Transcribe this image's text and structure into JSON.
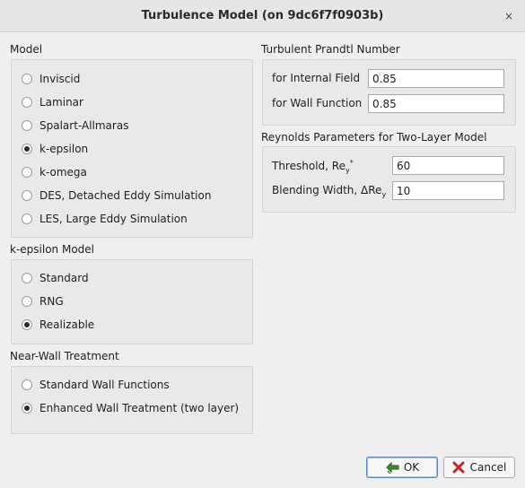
{
  "window": {
    "title": "Turbulence Model (on 9dc6f7f0903b)",
    "close_glyph": "×"
  },
  "model": {
    "label": "Model",
    "options": [
      "Inviscid",
      "Laminar",
      "Spalart-Allmaras",
      "k-epsilon",
      "k-omega",
      "DES, Detached Eddy Simulation",
      "LES, Large Eddy Simulation"
    ],
    "selected": "k-epsilon"
  },
  "kepsilon": {
    "label": "k-epsilon Model",
    "options": [
      "Standard",
      "RNG",
      "Realizable"
    ],
    "selected": "Realizable"
  },
  "near_wall": {
    "label": "Near-Wall Treatment",
    "options": [
      "Standard Wall Functions",
      "Enhanced Wall Treatment (two layer)"
    ],
    "selected": "Enhanced Wall Treatment (two layer)"
  },
  "prandtl": {
    "label": "Turbulent Prandtl Number",
    "internal_label": "for Internal Field",
    "internal_value": "0.85",
    "wall_label": "for Wall Function",
    "wall_value": "0.85"
  },
  "reynolds": {
    "label": "Reynolds Parameters for Two-Layer Model",
    "threshold_label": "Threshold, Re",
    "threshold_sub": "y",
    "threshold_sup": "*",
    "threshold_value": "60",
    "blending_label": "Blending Width, ΔRe",
    "blending_sub": "y",
    "blending_value": "10"
  },
  "buttons": {
    "ok": "OK",
    "cancel": "Cancel"
  },
  "colors": {
    "ok_icon": "#3f8a2e",
    "cancel_icon": "#c0282a"
  }
}
